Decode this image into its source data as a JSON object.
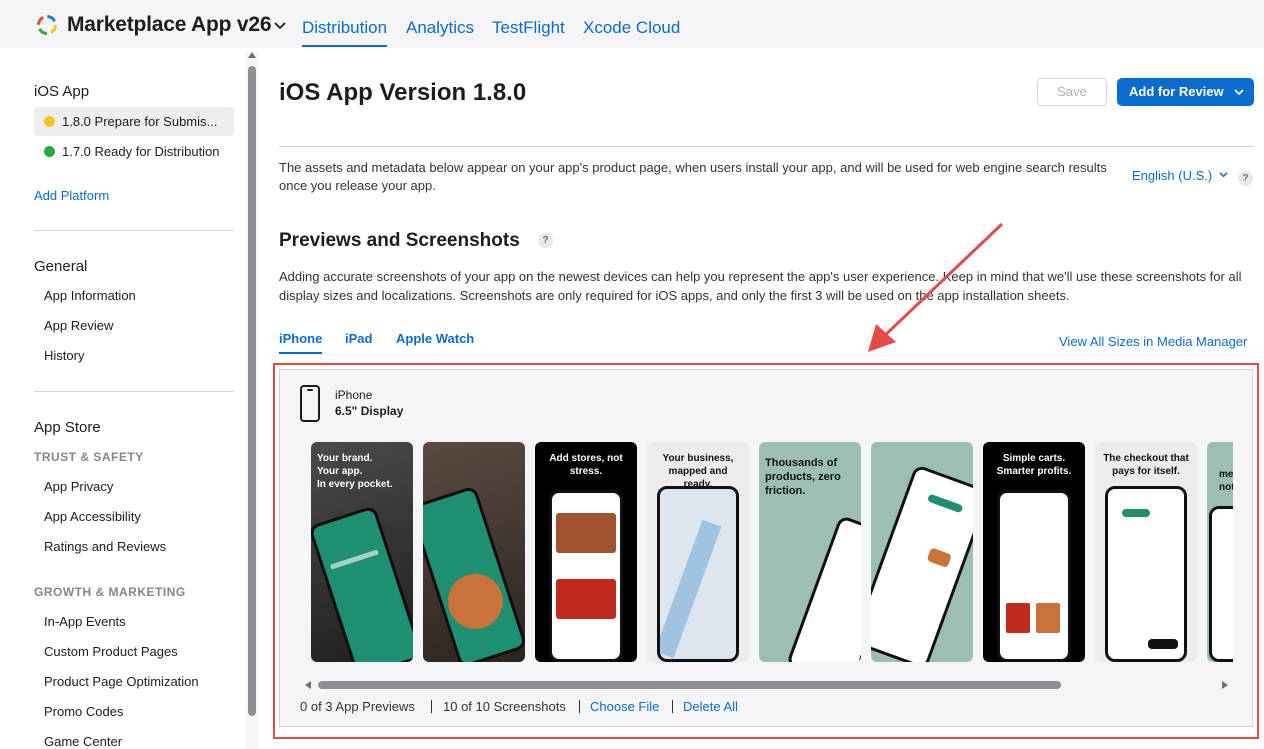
{
  "app": {
    "title": "Marketplace App v26",
    "tabs": [
      {
        "label": "Distribution",
        "active": true
      },
      {
        "label": "Analytics",
        "active": false
      },
      {
        "label": "TestFlight",
        "active": false
      },
      {
        "label": "Xcode Cloud",
        "active": false
      }
    ]
  },
  "sidebar": {
    "platform_heading": "iOS App",
    "versions": [
      {
        "label": "1.8.0 Prepare for Submis...",
        "status_color": "#f5c518",
        "selected": true
      },
      {
        "label": "1.7.0 Ready for Distribution",
        "status_color": "#28a745",
        "selected": false
      }
    ],
    "add_platform": "Add Platform",
    "general_heading": "General",
    "general_items": [
      "App Information",
      "App Review",
      "History"
    ],
    "appstore_heading": "App Store",
    "trust_heading": "TRUST & SAFETY",
    "trust_items": [
      "App Privacy",
      "App Accessibility",
      "Ratings and Reviews"
    ],
    "growth_heading": "GROWTH & MARKETING",
    "growth_items": [
      "In-App Events",
      "Custom Product Pages",
      "Product Page Optimization",
      "Promo Codes",
      "Game Center"
    ]
  },
  "main": {
    "title": "iOS App Version 1.8.0",
    "save_label": "Save",
    "review_label": "Add for Review",
    "intro": "The assets and metadata below appear on your app's product page, when users install your app, and will be used for web engine search results once you release your app.",
    "language": "English (U.S.)",
    "help_glyph": "?",
    "section_title": "Previews and Screenshots",
    "section_desc": "Adding accurate screenshots of your app on the newest devices can help you represent the app's user experience. Keep in mind that we'll use these screenshots for all display sizes and localizations. Screenshots are only required for iOS apps, and only the first 3 will be used on the app installation sheets.",
    "device_tabs": [
      {
        "label": "iPhone",
        "active": true
      },
      {
        "label": "iPad",
        "active": false
      },
      {
        "label": "Apple Watch",
        "active": false
      }
    ],
    "view_all": "View All Sizes in Media Manager"
  },
  "media": {
    "device_name": "iPhone",
    "device_size": "6.5\" Display",
    "screenshots": [
      {
        "caption": "Your brand.\nYour app.\nIn every pocket.",
        "bg": "#2a2a2a",
        "caption_color": "#ffffff",
        "align": "left"
      },
      {
        "caption": "",
        "bg": "#3a2f2a",
        "caption_color": "#ffffff",
        "align": "left"
      },
      {
        "caption": "Add stores, not stress.",
        "bg": "#000000",
        "caption_color": "#ffffff",
        "align": "center"
      },
      {
        "caption": "Your business, mapped and ready.",
        "bg": "#ececec",
        "caption_color": "#111111",
        "align": "center"
      },
      {
        "caption": "Thousands of products, zero friction.",
        "bg": "#9dbfb3",
        "caption_color": "#111111",
        "align": "left"
      },
      {
        "caption": "",
        "bg": "#9dbfb3",
        "caption_color": "#111111",
        "align": "left"
      },
      {
        "caption": "Simple carts. Smarter profits.",
        "bg": "#000000",
        "caption_color": "#ffffff",
        "align": "center"
      },
      {
        "caption": "The checkout that pays for itself.",
        "bg": "#ececec",
        "caption_color": "#111111",
        "align": "center"
      },
      {
        "caption": "me\nnotic",
        "bg": "#9dbfb3",
        "caption_color": "#111111",
        "align": "left"
      }
    ],
    "previews_count": "0 of 3 App Previews",
    "screenshots_count": "10 of 10 Screenshots",
    "choose_file": "Choose File",
    "delete_all": "Delete All"
  },
  "colors": {
    "accent": "#0a6ccc",
    "highlight_border": "#e34b46",
    "app_teal": "#1f8f72"
  }
}
